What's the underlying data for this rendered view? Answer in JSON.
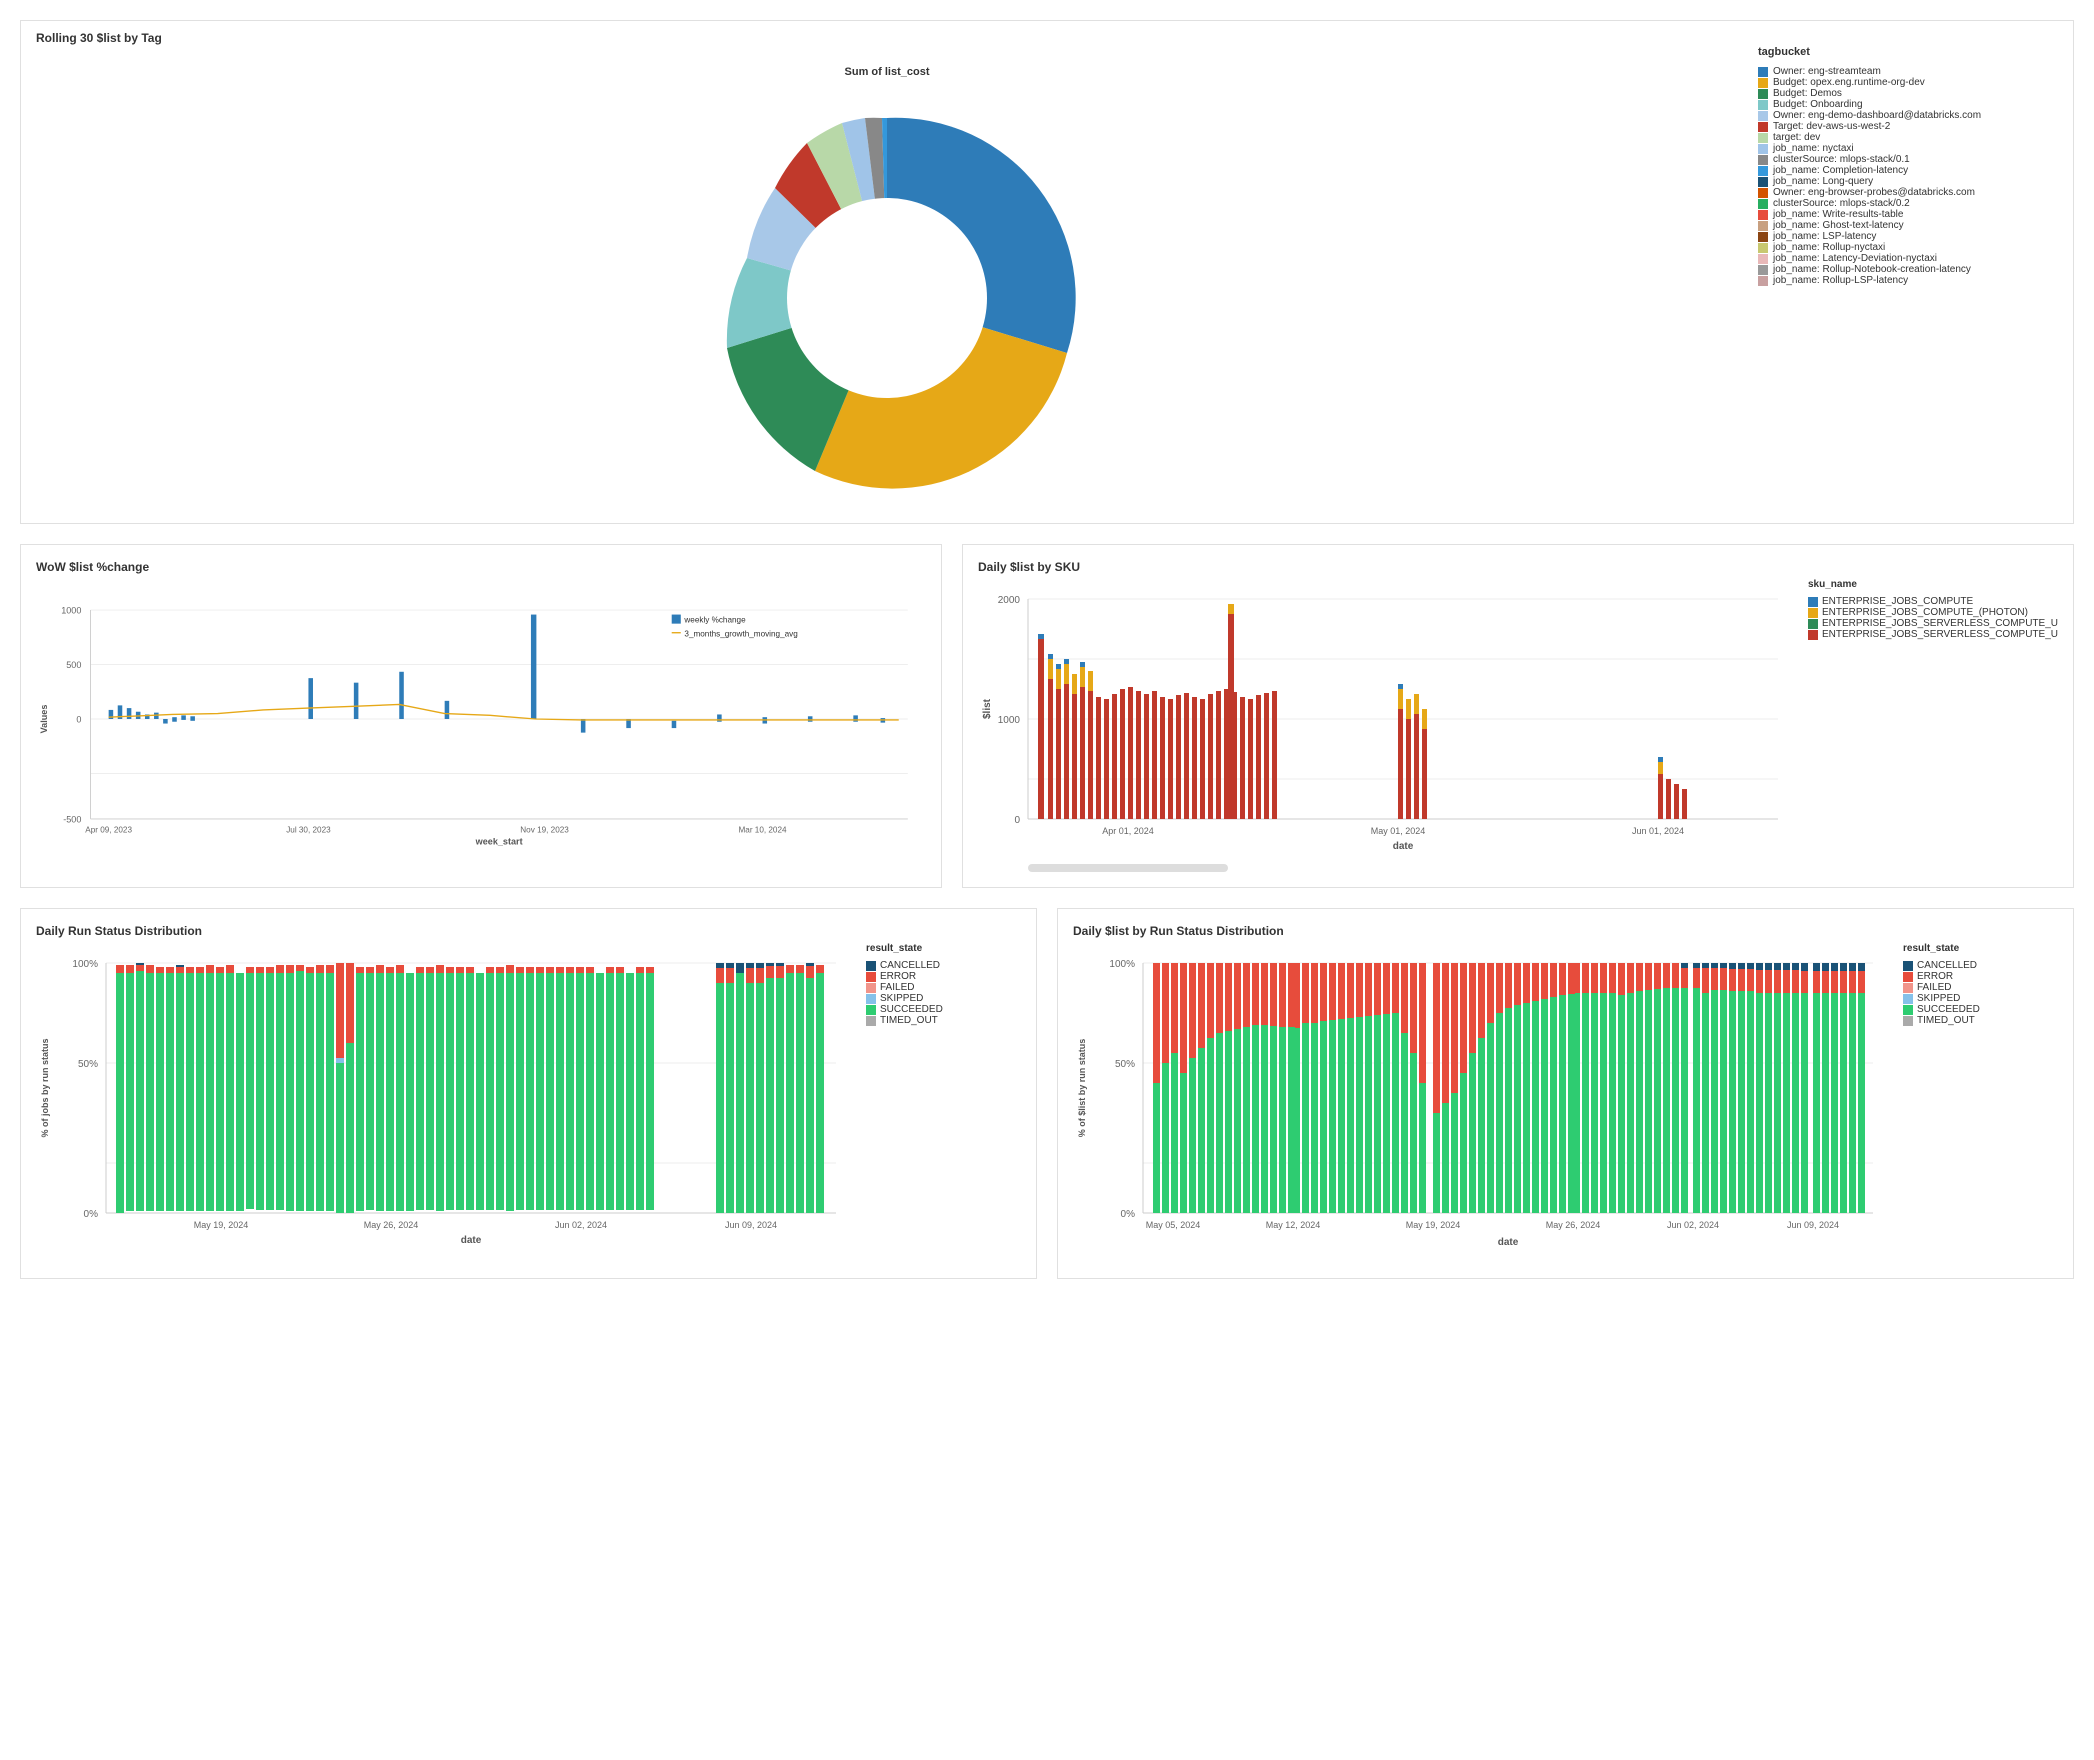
{
  "top_chart": {
    "title": "Rolling 30 $list by Tag",
    "subtitle": "Sum of list_cost",
    "legend_title": "tagbucket",
    "legend_items": [
      {
        "label": "Owner: eng-streamteam",
        "color": "#2e7cb8"
      },
      {
        "label": "Budget: opex.eng.runtime-org-dev",
        "color": "#e6a817"
      },
      {
        "label": "Budget: Demos",
        "color": "#2e8b57"
      },
      {
        "label": "Budget: Onboarding",
        "color": "#7ec8c8"
      },
      {
        "label": "Owner: eng-demo-dashboard@databricks.com",
        "color": "#a8c8e8"
      },
      {
        "label": "Target: dev-aws-us-west-2",
        "color": "#c0392b"
      },
      {
        "label": "target: dev",
        "color": "#b8d8a8"
      },
      {
        "label": "job_name: nyctaxi",
        "color": "#a0c4e8"
      },
      {
        "label": "clusterSource: mlops-stack/0.1",
        "color": "#888888"
      },
      {
        "label": "job_name: Completion-latency",
        "color": "#3498db"
      },
      {
        "label": "job_name: Long-query",
        "color": "#1a5276"
      },
      {
        "label": "Owner: eng-browser-probes@databricks.com",
        "color": "#d35400"
      },
      {
        "label": "clusterSource: mlops-stack/0.2",
        "color": "#27ae60"
      },
      {
        "label": "job_name: Write-results-table",
        "color": "#e74c3c"
      },
      {
        "label": "job_name: Ghost-text-latency",
        "color": "#c8a080"
      },
      {
        "label": "job_name: LSP-latency",
        "color": "#8b4513"
      },
      {
        "label": "job_name: Rollup-nyctaxi",
        "color": "#c8c870"
      },
      {
        "label": "job_name: Latency-Deviation-nyctaxi",
        "color": "#e8b8b8"
      },
      {
        "label": "job_name: Rollup-Notebook-creation-latency",
        "color": "#999999"
      },
      {
        "label": "job_name: Rollup-LSP-latency",
        "color": "#c8a0a0"
      }
    ]
  },
  "wow_chart": {
    "title": "WoW $list %change",
    "x_label": "week_start",
    "y_label": "Values",
    "x_ticks": [
      "Apr 09, 2023",
      "Jul 30, 2023",
      "Nov 19, 2023",
      "Mar 10, 2024"
    ],
    "y_ticks": [
      "-500",
      "0",
      "500",
      "1000"
    ],
    "legend": [
      {
        "label": "weekly %change",
        "color": "#1a5276"
      },
      {
        "label": "3_months_growth_moving_avg",
        "color": "#e6a817"
      }
    ]
  },
  "daily_sku_chart": {
    "title": "Daily $list by SKU",
    "x_label": "date",
    "y_label": "$list",
    "x_ticks": [
      "Apr 01, 2024",
      "May 01, 2024",
      "Jun 01, 2024"
    ],
    "y_ticks": [
      "0",
      "1000",
      "2000"
    ],
    "legend_title": "sku_name",
    "legend": [
      {
        "label": "ENTERPRISE_JOBS_COMPUTE",
        "color": "#2e7cb8"
      },
      {
        "label": "ENTERPRISE_JOBS_COMPUTE_(PHOTON)",
        "color": "#e6a817"
      },
      {
        "label": "ENTERPRISE_JOBS_SERVERLESS_COMPUTE_U",
        "color": "#2e8b57"
      },
      {
        "label": "ENTERPRISE_JOBS_SERVERLESS_COMPUTE_U",
        "color": "#c0392b"
      }
    ]
  },
  "daily_run_status": {
    "title": "Daily Run Status Distribution",
    "x_label": "date",
    "y_label": "% of jobs by run status",
    "x_ticks": [
      "May 19, 2024",
      "May 26, 2024",
      "Jun 02, 2024",
      "Jun 09, 2024"
    ],
    "y_ticks": [
      "0%",
      "50%",
      "100%"
    ],
    "legend_title": "result_state",
    "legend": [
      {
        "label": "CANCELLED",
        "color": "#1a5276"
      },
      {
        "label": "ERROR",
        "color": "#e74c3c"
      },
      {
        "label": "FAILED",
        "color": "#f1948a"
      },
      {
        "label": "SKIPPED",
        "color": "#85c1e9"
      },
      {
        "label": "SUCCEEDED",
        "color": "#2ecc71"
      },
      {
        "label": "TIMED_OUT",
        "color": "#aaaaaa"
      }
    ]
  },
  "daily_list_run_status": {
    "title": "Daily $list by Run Status Distribution",
    "x_label": "date",
    "y_label": "% of $list by run status",
    "x_ticks": [
      "May 05, 2024",
      "May 12, 2024",
      "May 19, 2024",
      "May 26, 2024",
      "Jun 02, 2024",
      "Jun 09, 2024"
    ],
    "y_ticks": [
      "0%",
      "50%",
      "100%"
    ],
    "legend_title": "result_state",
    "legend": [
      {
        "label": "CANCELLED",
        "color": "#1a5276"
      },
      {
        "label": "ERROR",
        "color": "#e74c3c"
      },
      {
        "label": "FAILED",
        "color": "#f1948a"
      },
      {
        "label": "SKIPPED",
        "color": "#85c1e9"
      },
      {
        "label": "SUCCEEDED",
        "color": "#2ecc71"
      },
      {
        "label": "TIMED_OUT",
        "color": "#aaaaaa"
      }
    ]
  }
}
